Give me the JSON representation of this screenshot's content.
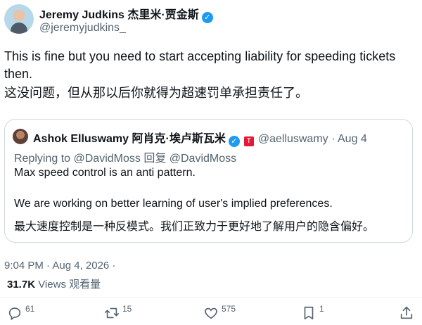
{
  "author": {
    "name": "Jeremy Judkins 杰里米·贾金斯",
    "handle": "@jeremyjudkins_"
  },
  "post": {
    "text_en": "This is fine but you need to start accepting liability for speeding tickets then.",
    "text_zh": "这没问题，但从那以后你就得为超速罚单承担责任了。"
  },
  "quoted": {
    "name": "Ashok Elluswamy 阿肖克·埃卢斯瓦米",
    "handle_date": "@aelluswamy · Aug 4",
    "replying": "Replying to @DavidMoss 回复 @DavidMoss",
    "line1": "Max speed control is an anti pattern.",
    "line2": "We are working on better learning of user's implied preferences.",
    "line3": "最大速度控制是一种反模式。我们正致力于更好地了解用户的隐含偏好。"
  },
  "meta": {
    "timestamp": "9:04 PM · Aug 4, 2026 ·",
    "views_count": "31.7K",
    "views_label": "Views 观看量"
  },
  "actions": {
    "replies": "61",
    "reposts": "15",
    "likes": "575",
    "bookmarks": "1"
  },
  "colors": {
    "verified": "#1d9bf0",
    "tesla_badge": "#e31937",
    "secondary_text": "#536471"
  },
  "icons": [
    "verified-icon",
    "tesla-badge-icon",
    "reply-icon",
    "repost-icon",
    "like-icon",
    "bookmark-icon",
    "share-icon"
  ]
}
